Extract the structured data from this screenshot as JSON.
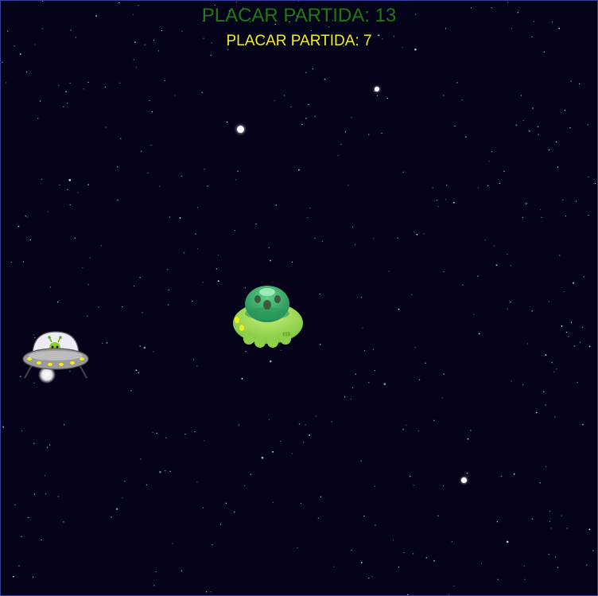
{
  "hud": {
    "score_primary": "PLACAR PARTIDA: 13",
    "score_secondary": "PLACAR PARTIDA: 7"
  },
  "colors": {
    "background": "#05031a",
    "border": "#3b3fa0",
    "score_primary": "#1f7a12",
    "score_secondary": "#f2ee1e",
    "star": "#ffffff"
  },
  "sprites": {
    "player": "flying-saucer-with-green-alien-icon",
    "enemy": "green-blob-ufo-icon"
  }
}
